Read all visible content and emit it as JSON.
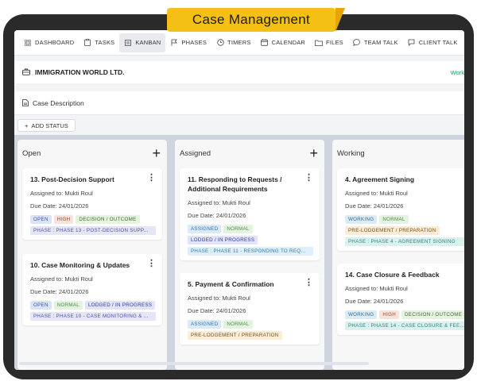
{
  "banner": {
    "title": "Case Management"
  },
  "nav": {
    "items": [
      {
        "label": "DASHBOARD",
        "icon": "grid-icon"
      },
      {
        "label": "TASKS",
        "icon": "clipboard-icon"
      },
      {
        "label": "KANBAN",
        "icon": "kanban-icon",
        "active": true
      },
      {
        "label": "PHASES",
        "icon": "flag-icon"
      },
      {
        "label": "TIMERS",
        "icon": "clock-icon"
      },
      {
        "label": "CALENDAR",
        "icon": "calendar-icon"
      },
      {
        "label": "FILES",
        "icon": "folder-icon"
      },
      {
        "label": "TEAM TALK",
        "icon": "chat-icon"
      },
      {
        "label": "CLIENT TALK",
        "icon": "chat-icon"
      }
    ]
  },
  "company": {
    "name": "IMMIGRATION WORLD LTD.",
    "status_partial": "Work"
  },
  "description": {
    "label": "Case Description"
  },
  "toolbar": {
    "add_status_label": "ADD STATUS"
  },
  "columns": [
    {
      "title": "Open",
      "cards": [
        {
          "title": "13. Post-Decision Support",
          "assigned": "Assigned to: Mukti Roul",
          "due": "Due Date: 24/01/2026",
          "tags": [
            "OPEN",
            "HIGH",
            "DECISION / OUTCOME"
          ],
          "phase": "PHASE : PHASE 13 - POST-DECISION SUPP..."
        },
        {
          "title": "10. Case Monitoring & Updates",
          "assigned": "Assigned to: Mukti Roul",
          "due": "Due Date: 24/01/2026",
          "tags": [
            "OPEN",
            "NORMAL",
            "LODGED / IN PROGRESS"
          ],
          "phase": "PHASE : PHASE 10 - CASE MONITORING & ..."
        }
      ]
    },
    {
      "title": "Assigned",
      "cards": [
        {
          "title": "11. Responding to Requests / Additional Requirements",
          "assigned": "Assigned to: Mukti Roul",
          "due": "Due Date: 24/01/2026",
          "tags": [
            "ASSIGNED",
            "NORMAL",
            "LODGED / IN PROGRESS"
          ],
          "phase": "PHASE : PHASE 11 - RESPONDING TO REQ..."
        },
        {
          "title": "5. Payment & Confirmation",
          "assigned": "Assigned to: Mukti Roul",
          "due": "Due Date: 24/01/2026",
          "tags": [
            "ASSIGNED",
            "NORMAL",
            "PRE-LODGEMENT / PREPARATION"
          ],
          "phase": ""
        }
      ]
    },
    {
      "title": "Working",
      "cards": [
        {
          "title": "4. Agreement Signing",
          "assigned": "Assigned to: Mukti Roul",
          "due": "Due Date: 24/01/2026",
          "tags": [
            "WORKING",
            "NORMAL",
            "PRE-LODGEMENT / PREPARATION"
          ],
          "phase": "PHASE : PHASE 4 - AGREEMENT SIGNING"
        },
        {
          "title": "14. Case Closure & Feedback",
          "assigned": "Assigned to: Mukti Roul",
          "due": "Due Date: 24/01/2026",
          "tags": [
            "WORKING",
            "HIGH",
            "DECISION / OUTCOME"
          ],
          "phase": "PHASE : PHASE 14 - CASE CLOSURE & FEE..."
        }
      ]
    }
  ]
}
